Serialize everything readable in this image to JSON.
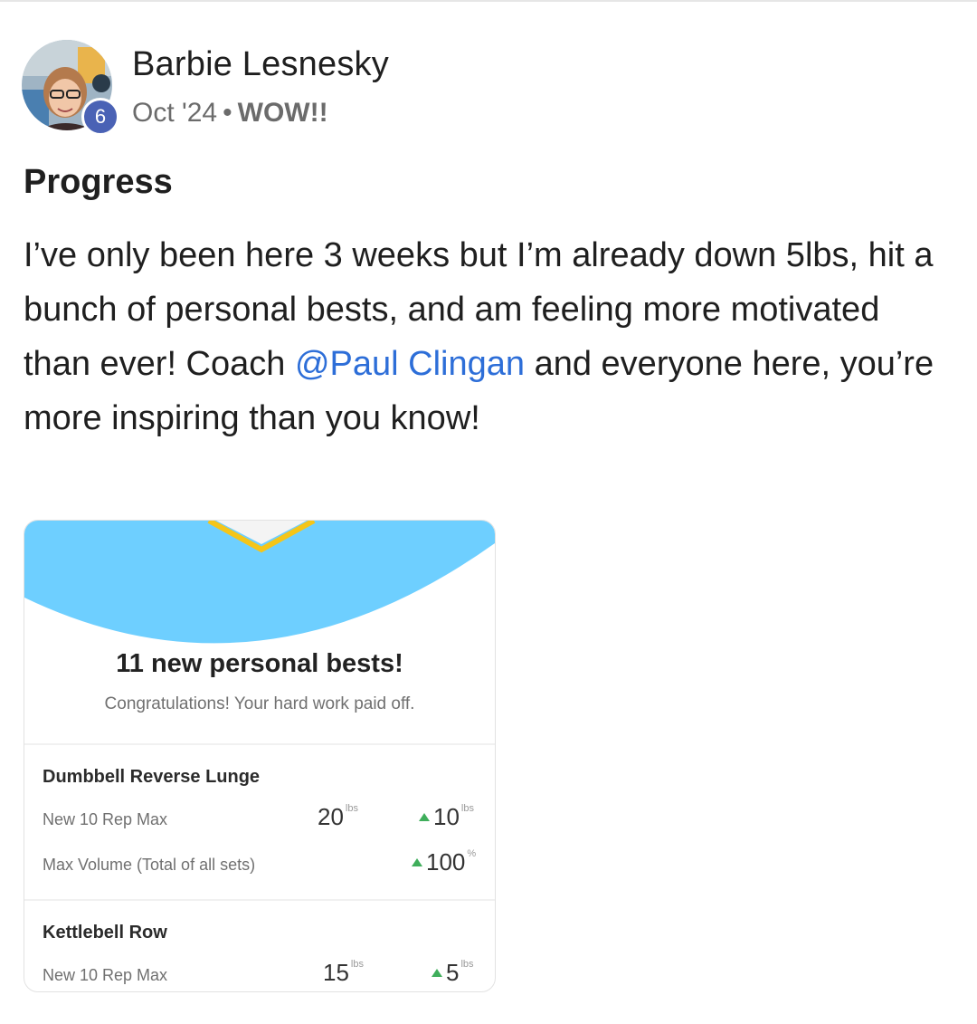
{
  "post": {
    "author": "Barbie Lesnesky",
    "level": "6",
    "date": "Oct '24",
    "separator": "•",
    "category": "WOW!!",
    "title": "Progress",
    "body_part1": "I’ve only been here 3 weeks but I’m already down 5lbs, hit a bunch of personal bests, and am feeling more motivated than ever! Coach ",
    "mention": "@Paul Clingan",
    "body_part2": " and everyone here, you’re more inspiring than you know!"
  },
  "card": {
    "headline": "11 new personal bests!",
    "subtitle": "Congratulations! Your hard work paid off.",
    "exercises": [
      {
        "name": "Dumbbell Reverse Lunge",
        "rows": [
          {
            "label": "New 10 Rep Max",
            "value": "20",
            "value_unit": "lbs",
            "delta": "10",
            "delta_unit": "lbs"
          },
          {
            "label": "Max Volume (Total of all sets)",
            "value": "",
            "value_unit": "",
            "delta": "100",
            "delta_unit": "%"
          }
        ]
      },
      {
        "name": "Kettlebell Row",
        "rows": [
          {
            "label": "New 10 Rep Max",
            "value": "15",
            "value_unit": "lbs",
            "delta": "5",
            "delta_unit": "lbs"
          }
        ]
      }
    ]
  },
  "colors": {
    "mention": "#2d6ed8",
    "badge": "#4a62b5",
    "banner": "#6ecfff",
    "ribbon": "#f5c518",
    "up_arrow": "#3fae5b"
  }
}
